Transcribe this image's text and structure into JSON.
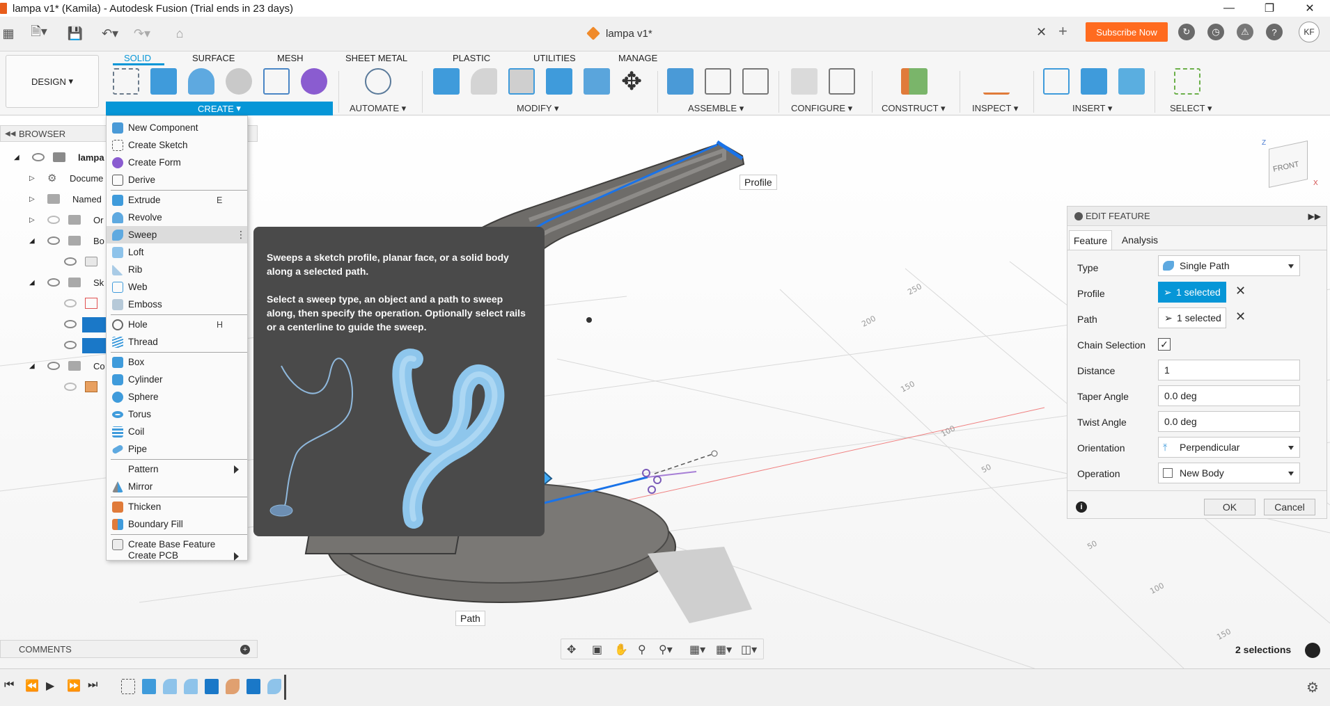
{
  "window": {
    "title": "lampa v1* (Kamila) - Autodesk Fusion (Trial ends in 23 days)",
    "doc_tab": "lampa v1*",
    "subscribe": "Subscribe Now",
    "user_initials": "KF"
  },
  "ribbon": {
    "workspace": "DESIGN",
    "tabs": [
      "SOLID",
      "SURFACE",
      "MESH",
      "SHEET METAL",
      "PLASTIC",
      "UTILITIES",
      "MANAGE"
    ],
    "groups": [
      "CREATE",
      "AUTOMATE",
      "MODIFY",
      "ASSEMBLE",
      "CONFIGURE",
      "CONSTRUCT",
      "INSPECT",
      "INSERT",
      "SELECT"
    ]
  },
  "browser": {
    "title": "BROWSER",
    "rows": [
      "lampa",
      "Docume",
      "Named",
      "Or",
      "Bo",
      "Sk",
      "Co"
    ]
  },
  "create_menu": {
    "items": [
      {
        "label": "New Component"
      },
      {
        "label": "Create Sketch"
      },
      {
        "label": "Create Form"
      },
      {
        "label": "Derive"
      },
      {
        "label": "Extrude",
        "key": "E"
      },
      {
        "label": "Revolve"
      },
      {
        "label": "Sweep"
      },
      {
        "label": "Loft"
      },
      {
        "label": "Rib"
      },
      {
        "label": "Web"
      },
      {
        "label": "Emboss"
      },
      {
        "label": "Hole",
        "key": "H"
      },
      {
        "label": "Thread"
      },
      {
        "label": "Box"
      },
      {
        "label": "Cylinder"
      },
      {
        "label": "Sphere"
      },
      {
        "label": "Torus"
      },
      {
        "label": "Coil"
      },
      {
        "label": "Pipe"
      },
      {
        "label": "Pattern"
      },
      {
        "label": "Mirror"
      },
      {
        "label": "Thicken"
      },
      {
        "label": "Boundary Fill"
      },
      {
        "label": "Create Base Feature"
      },
      {
        "label": "Create PCB"
      }
    ]
  },
  "tooltip": {
    "line1": "Sweeps a sketch profile, planar face, or a solid body along a selected path.",
    "line2": "Select a sweep type, an object and a path to sweep along, then specify the operation. Optionally select rails or a centerline to guide the sweep."
  },
  "edit_feature": {
    "title": "EDIT FEATURE",
    "tabs": [
      "Feature",
      "Analysis"
    ],
    "type_label": "Type",
    "type_value": "Single Path",
    "profile_label": "Profile",
    "profile_value": "1 selected",
    "path_label": "Path",
    "path_value": "1 selected",
    "chain_label": "Chain Selection",
    "distance_label": "Distance",
    "distance_value": "1",
    "taper_label": "Taper Angle",
    "taper_value": "0.0 deg",
    "twist_label": "Twist Angle",
    "twist_value": "0.0 deg",
    "orientation_label": "Orientation",
    "orientation_value": "Perpendicular",
    "operation_label": "Operation",
    "operation_value": "New Body",
    "ok": "OK",
    "cancel": "Cancel"
  },
  "viewport": {
    "profile_tag": "Profile",
    "path_tag": "Path",
    "viewcube_face": "FRONT",
    "grid_labels": [
      "250",
      "200",
      "150",
      "100",
      "50",
      "50",
      "100",
      "150"
    ]
  },
  "comments": "COMMENTS",
  "status": {
    "selections": "2 selections"
  }
}
